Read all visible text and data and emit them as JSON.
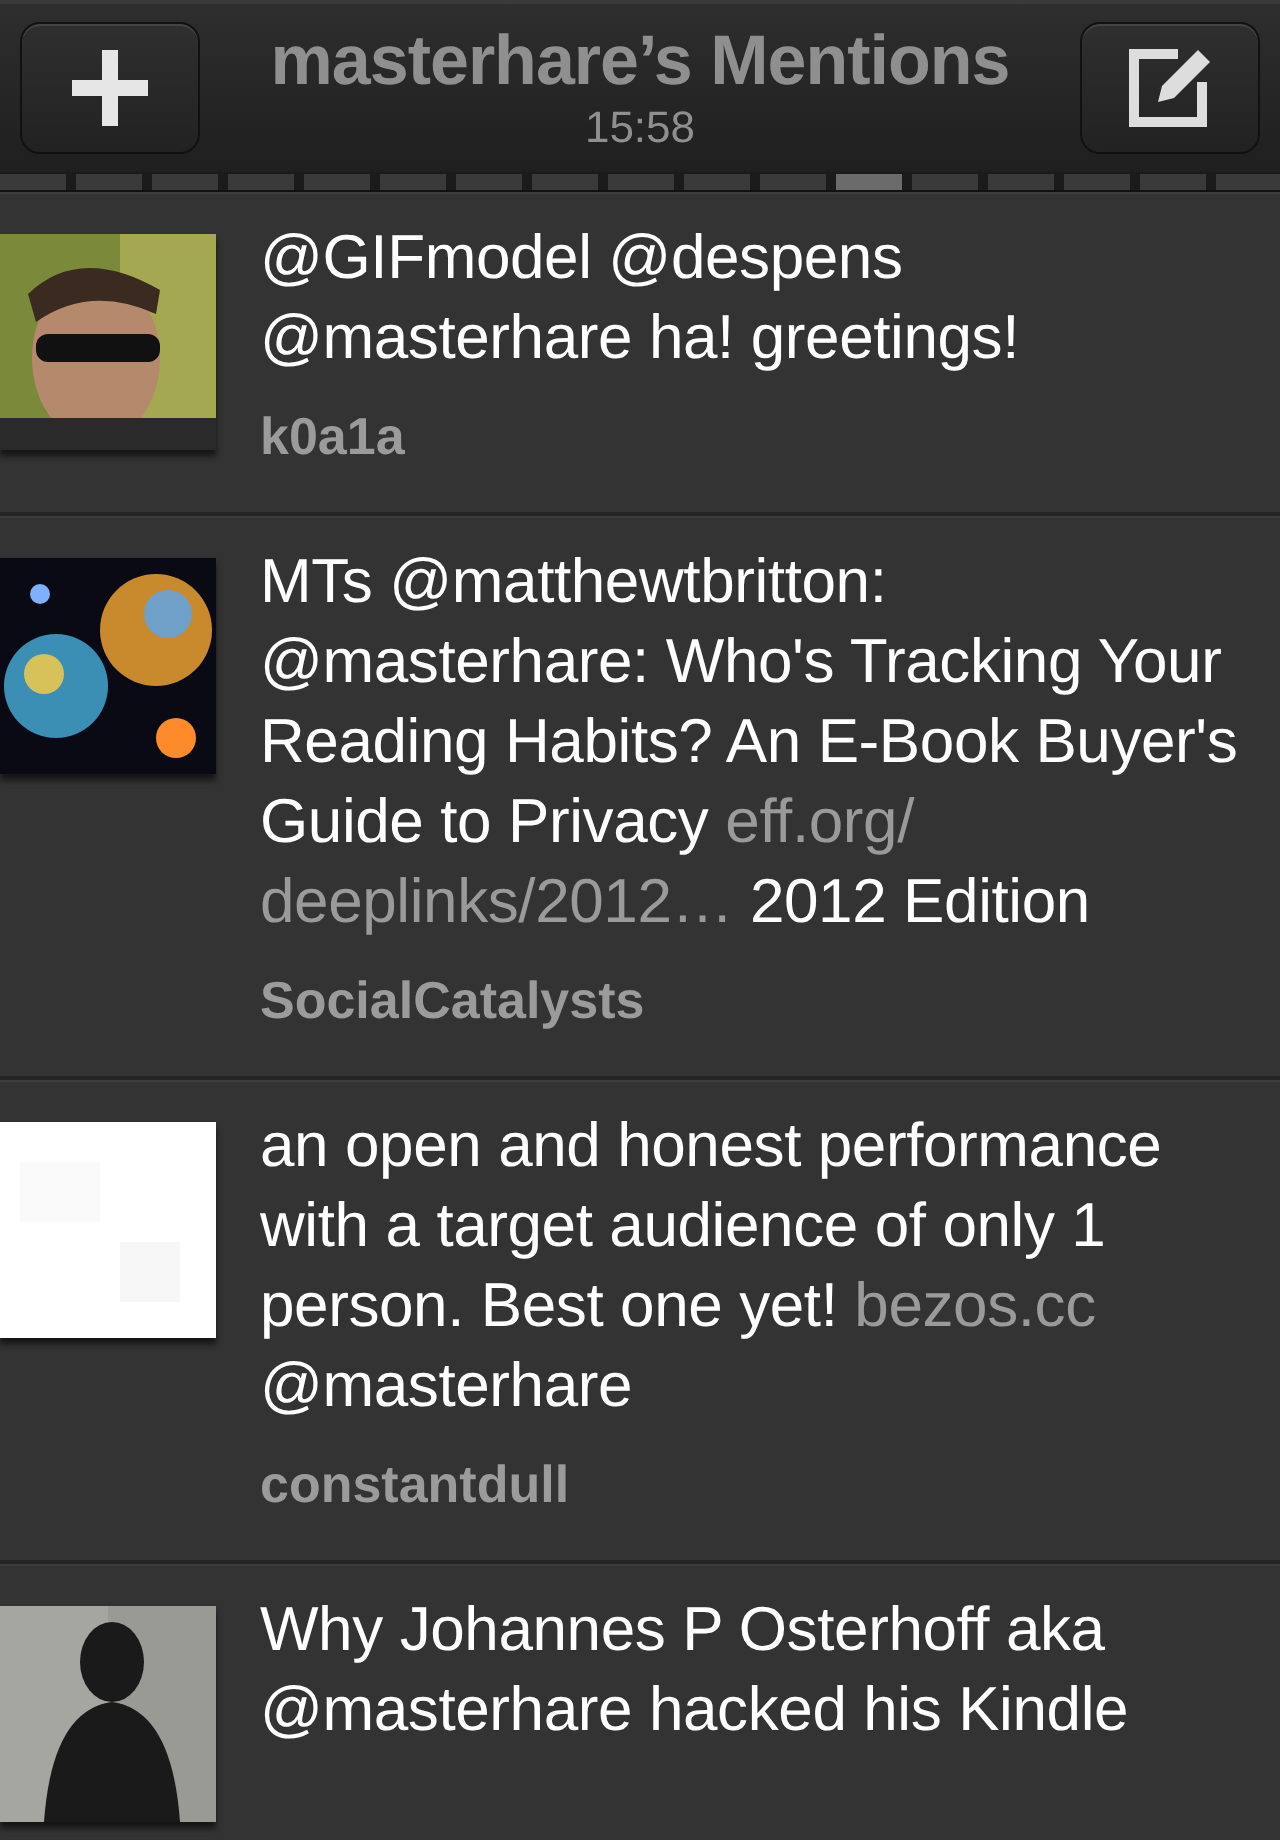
{
  "header": {
    "title": "masterhare’s Mentions",
    "time": "15:58"
  },
  "pages": [
    {
      "selected": false
    },
    {
      "selected": false
    },
    {
      "selected": false
    },
    {
      "selected": false
    },
    {
      "selected": false
    },
    {
      "selected": false
    },
    {
      "selected": false
    },
    {
      "selected": false
    },
    {
      "selected": false
    },
    {
      "selected": false
    },
    {
      "selected": false
    },
    {
      "selected": true
    },
    {
      "selected": false
    },
    {
      "selected": false
    },
    {
      "selected": false
    },
    {
      "selected": false
    },
    {
      "selected": false
    }
  ],
  "tweets": [
    {
      "avatar": {
        "kind": "picture"
      },
      "segments": [
        {
          "kind": "text",
          "text": "@GIFmodel @despens @masterhare ha! greetings!"
        }
      ],
      "user": "k0a1a"
    },
    {
      "avatar": {
        "kind": "picture"
      },
      "segments": [
        {
          "kind": "text",
          "text": "MTs @matthewtbritton: @masterhare: Who's Tracking Your Reading Habits? An E-Book Buyer's Guide to Privacy "
        },
        {
          "kind": "link",
          "text": "eff.org/"
        },
        {
          "kind": "link",
          "text": "deeplinks/2012…"
        },
        {
          "kind": "text",
          "text": " 2012 Edition"
        }
      ],
      "user": "SocialCatalysts"
    },
    {
      "avatar": {
        "kind": "picture"
      },
      "segments": [
        {
          "kind": "text",
          "text": "an open and honest performance with a target audience of only 1 person. Best one yet! "
        },
        {
          "kind": "link",
          "text": "bezos.cc"
        },
        {
          "kind": "text",
          "text": " @masterhare"
        }
      ],
      "user": "constantdull"
    },
    {
      "avatar": {
        "kind": "picture"
      },
      "segments": [
        {
          "kind": "text",
          "text": "Why Johannes P Osterhoff aka @masterhare hacked his Kindle"
        }
      ]
    }
  ]
}
